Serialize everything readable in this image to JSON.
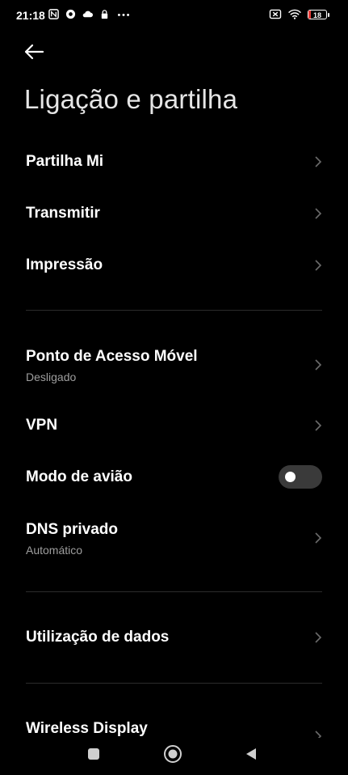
{
  "status_bar": {
    "time": "21:18",
    "battery_level": "18",
    "icons_left": [
      "nfc-icon",
      "shield-icon",
      "cloud-icon",
      "lock-icon",
      "more-dots-icon"
    ],
    "icons_right": [
      "no-sim-icon",
      "wifi-icon",
      "battery-icon"
    ]
  },
  "header": {
    "title": "Ligação e partilha"
  },
  "items": [
    {
      "label": "Partilha Mi"
    },
    {
      "label": "Transmitir"
    },
    {
      "label": "Impressão"
    },
    {
      "label": "Ponto de Acesso Móvel",
      "sub": "Desligado"
    },
    {
      "label": "VPN"
    },
    {
      "label": "Modo de avião",
      "toggle": false
    },
    {
      "label": "DNS privado",
      "sub": "Automático"
    },
    {
      "label": "Utilização de dados"
    },
    {
      "label": "Wireless Display"
    }
  ],
  "colors": {
    "background": "#000000",
    "text": "#ffffff",
    "subtext": "#9e9e9e",
    "toggle_off": "#3a3a3a"
  }
}
